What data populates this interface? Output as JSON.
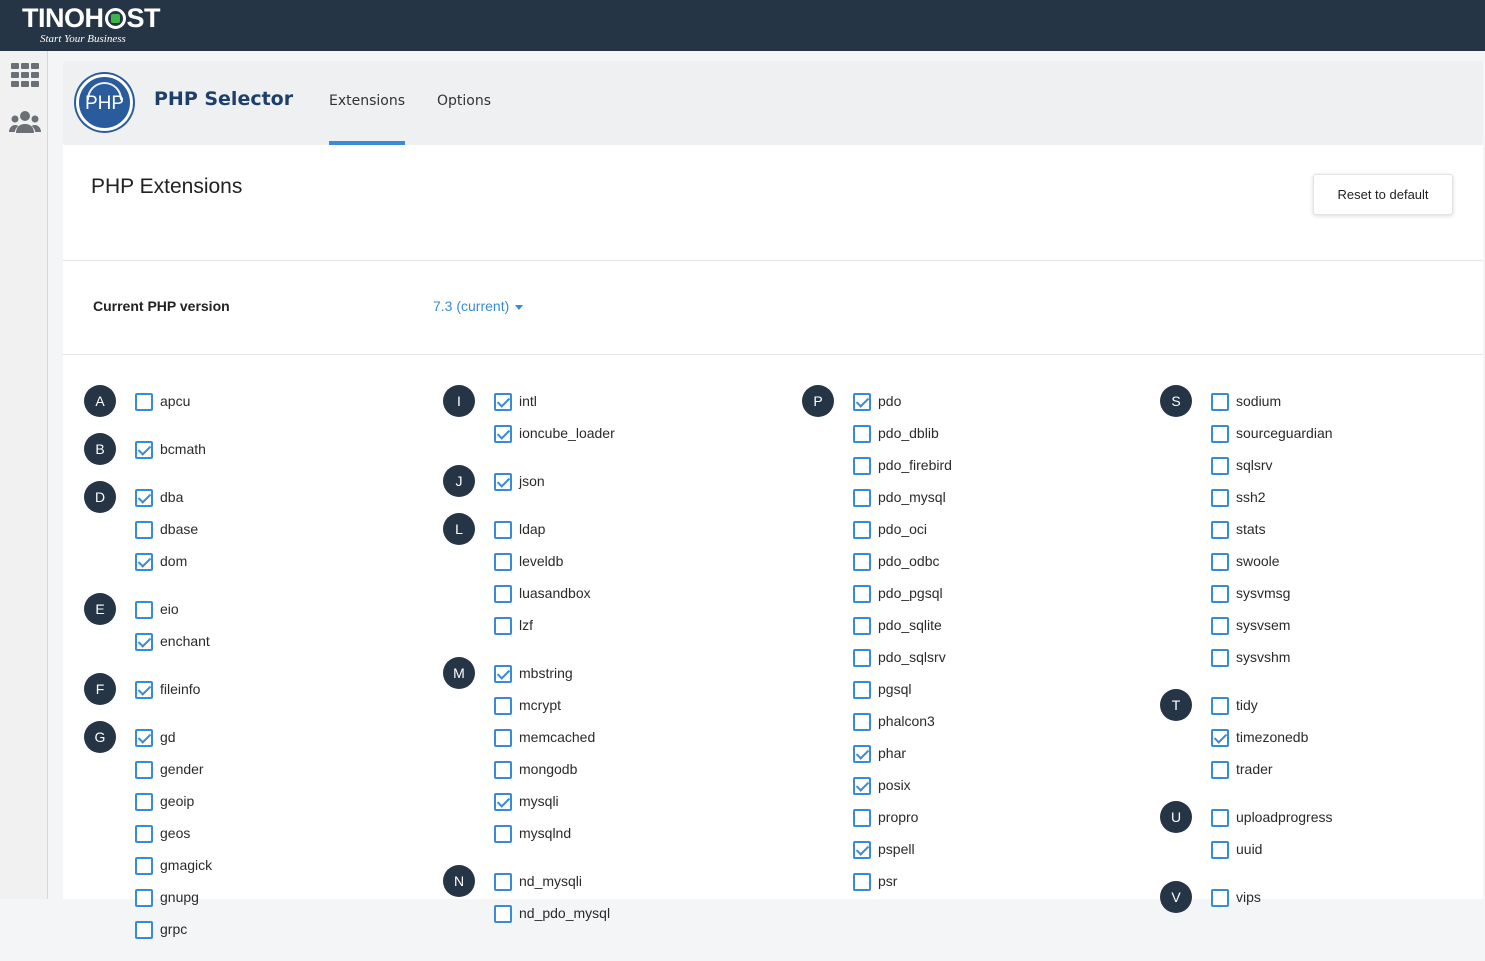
{
  "brand": {
    "name_left": "TINOH",
    "name_right": "ST",
    "tagline": "Start Your Business"
  },
  "header": {
    "logo_text": "PHP",
    "title": "PHP Selector",
    "tabs": [
      {
        "label": "Extensions",
        "active": true
      },
      {
        "label": "Options",
        "active": false
      }
    ]
  },
  "main": {
    "section_title": "PHP Extensions",
    "reset_label": "Reset to default",
    "version_label": "Current PHP version",
    "version_value": "7.3 (current)"
  },
  "columns": [
    [
      {
        "letter": "A",
        "items": [
          {
            "name": "apcu",
            "checked": false
          }
        ]
      },
      {
        "letter": "B",
        "items": [
          {
            "name": "bcmath",
            "checked": true
          }
        ]
      },
      {
        "letter": "D",
        "items": [
          {
            "name": "dba",
            "checked": true
          },
          {
            "name": "dbase",
            "checked": false
          },
          {
            "name": "dom",
            "checked": true
          }
        ]
      },
      {
        "letter": "E",
        "items": [
          {
            "name": "eio",
            "checked": false
          },
          {
            "name": "enchant",
            "checked": true
          }
        ]
      },
      {
        "letter": "F",
        "items": [
          {
            "name": "fileinfo",
            "checked": true
          }
        ]
      },
      {
        "letter": "G",
        "items": [
          {
            "name": "gd",
            "checked": true
          },
          {
            "name": "gender",
            "checked": false
          },
          {
            "name": "geoip",
            "checked": false
          },
          {
            "name": "geos",
            "checked": false
          },
          {
            "name": "gmagick",
            "checked": false
          },
          {
            "name": "gnupg",
            "checked": false
          },
          {
            "name": "grpc",
            "checked": false
          }
        ]
      }
    ],
    [
      {
        "letter": "I",
        "items": [
          {
            "name": "intl",
            "checked": true
          },
          {
            "name": "ioncube_loader",
            "checked": true
          }
        ]
      },
      {
        "letter": "J",
        "items": [
          {
            "name": "json",
            "checked": true
          }
        ]
      },
      {
        "letter": "L",
        "items": [
          {
            "name": "ldap",
            "checked": false
          },
          {
            "name": "leveldb",
            "checked": false
          },
          {
            "name": "luasandbox",
            "checked": false
          },
          {
            "name": "lzf",
            "checked": false
          }
        ]
      },
      {
        "letter": "M",
        "items": [
          {
            "name": "mbstring",
            "checked": true
          },
          {
            "name": "mcrypt",
            "checked": false
          },
          {
            "name": "memcached",
            "checked": false
          },
          {
            "name": "mongodb",
            "checked": false
          },
          {
            "name": "mysqli",
            "checked": true
          },
          {
            "name": "mysqlnd",
            "checked": false
          }
        ]
      },
      {
        "letter": "N",
        "items": [
          {
            "name": "nd_mysqli",
            "checked": false
          },
          {
            "name": "nd_pdo_mysql",
            "checked": false
          }
        ]
      }
    ],
    [
      {
        "letter": "P",
        "items": [
          {
            "name": "pdo",
            "checked": true
          },
          {
            "name": "pdo_dblib",
            "checked": false
          },
          {
            "name": "pdo_firebird",
            "checked": false
          },
          {
            "name": "pdo_mysql",
            "checked": false
          },
          {
            "name": "pdo_oci",
            "checked": false
          },
          {
            "name": "pdo_odbc",
            "checked": false
          },
          {
            "name": "pdo_pgsql",
            "checked": false
          },
          {
            "name": "pdo_sqlite",
            "checked": false
          },
          {
            "name": "pdo_sqlsrv",
            "checked": false
          },
          {
            "name": "pgsql",
            "checked": false
          },
          {
            "name": "phalcon3",
            "checked": false
          },
          {
            "name": "phar",
            "checked": true
          },
          {
            "name": "posix",
            "checked": true
          },
          {
            "name": "propro",
            "checked": false
          },
          {
            "name": "pspell",
            "checked": true
          },
          {
            "name": "psr",
            "checked": false
          }
        ]
      }
    ],
    [
      {
        "letter": "S",
        "items": [
          {
            "name": "sodium",
            "checked": false
          },
          {
            "name": "sourceguardian",
            "checked": false
          },
          {
            "name": "sqlsrv",
            "checked": false
          },
          {
            "name": "ssh2",
            "checked": false
          },
          {
            "name": "stats",
            "checked": false
          },
          {
            "name": "swoole",
            "checked": false
          },
          {
            "name": "sysvmsg",
            "checked": false
          },
          {
            "name": "sysvsem",
            "checked": false
          },
          {
            "name": "sysvshm",
            "checked": false
          }
        ]
      },
      {
        "letter": "T",
        "items": [
          {
            "name": "tidy",
            "checked": false
          },
          {
            "name": "timezonedb",
            "checked": true
          },
          {
            "name": "trader",
            "checked": false
          }
        ]
      },
      {
        "letter": "U",
        "items": [
          {
            "name": "uploadprogress",
            "checked": false
          },
          {
            "name": "uuid",
            "checked": false
          }
        ]
      },
      {
        "letter": "V",
        "items": [
          {
            "name": "vips",
            "checked": false
          }
        ]
      }
    ]
  ],
  "colors": {
    "topbar": "#263545",
    "accent": "#3a8bd5",
    "title": "#1f3f6b",
    "letter_badge": "#263545"
  },
  "icons": {
    "nav_apps": "grid-icon",
    "nav_users": "users-icon"
  }
}
